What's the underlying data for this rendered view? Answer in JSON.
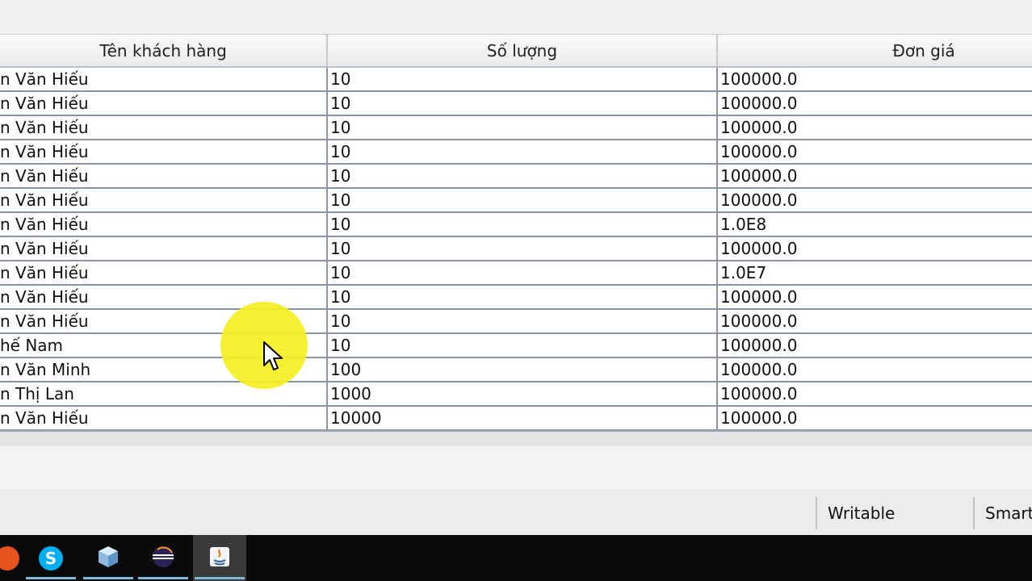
{
  "table": {
    "headers": [
      "Tên khách hàng",
      "Số lượng",
      "Đơn giá"
    ],
    "rows": [
      [
        "n Văn Hiếu",
        "10",
        "100000.0"
      ],
      [
        "n Văn Hiếu",
        "10",
        "100000.0"
      ],
      [
        "n Văn Hiếu",
        "10",
        "100000.0"
      ],
      [
        "n Văn Hiếu",
        "10",
        "100000.0"
      ],
      [
        "n Văn Hiếu",
        "10",
        "100000.0"
      ],
      [
        "n Văn Hiếu",
        "10",
        "100000.0"
      ],
      [
        "n Văn Hiếu",
        "10",
        "1.0E8"
      ],
      [
        "n Văn Hiếu",
        "10",
        "100000.0"
      ],
      [
        "n Văn Hiếu",
        "10",
        "1.0E7"
      ],
      [
        "n Văn Hiếu",
        "10",
        "100000.0"
      ],
      [
        "n Văn Hiếu",
        "10",
        "100000.0"
      ],
      [
        "hế Nam",
        "10",
        "100000.0"
      ],
      [
        "n Văn Minh",
        "100",
        "100000.0"
      ],
      [
        "n Thị Lan",
        "1000",
        "100000.0"
      ],
      [
        "n Văn Hiếu",
        "10000",
        "100000.0"
      ]
    ]
  },
  "status_bar": {
    "writable": "Writable",
    "smart_insert": "Smart"
  },
  "taskbar": {
    "items": [
      {
        "icon": "app-icon-partial",
        "color": "#e8541e"
      },
      {
        "icon": "skype-icon",
        "color": "#00aff0",
        "glyph": "S"
      },
      {
        "icon": "cube-icon",
        "color": "#9fc4e8"
      },
      {
        "icon": "eclipse-icon",
        "color": "#2c2255"
      },
      {
        "icon": "java-icon",
        "color": "#e76f00"
      }
    ]
  },
  "colors": {
    "cursor_highlight": "#f4ef1f",
    "grid_line": "#8b95a5",
    "taskbar_bg": "#0a0a0a"
  }
}
